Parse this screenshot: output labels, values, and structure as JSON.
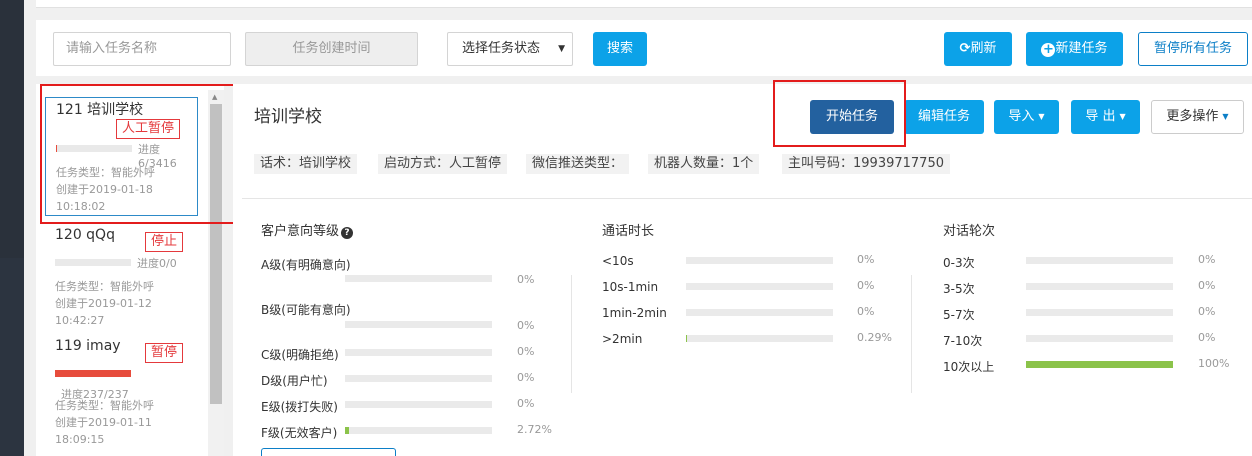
{
  "toolbar": {
    "task_name_placeholder": "请输入任务名称",
    "created_time_placeholder": "任务创建时间",
    "status_select": "选择任务状态",
    "search_label": "搜索",
    "refresh_label": "刷新",
    "new_task_label": "新建任务",
    "pause_all_label": "暂停所有任务"
  },
  "tasks": [
    {
      "name": "121 培训学校",
      "status": "人工暂停",
      "progress": "进度6/3416",
      "progress_fraction": 0.0018,
      "type": "任务类型：智能外呼",
      "created": "创建于2019-01-18",
      "time": "10:18:02"
    },
    {
      "name": "120 qQq",
      "status": "停止",
      "progress": "进度0/0",
      "progress_fraction": 0,
      "type": "任务类型：智能外呼",
      "created": "创建于2019-01-12",
      "time": "10:42:27"
    },
    {
      "name": "119 imay",
      "status": "暂停",
      "progress": "进度237/237",
      "progress_fraction": 1,
      "type": "任务类型：智能外呼",
      "created": "创建于2019-01-11",
      "time": "18:09:15"
    }
  ],
  "detail": {
    "title": "培训学校",
    "actions": {
      "start": "开始任务",
      "edit": "编辑任务",
      "import": "导入",
      "export": "导 出",
      "more": "更多操作"
    },
    "chips": [
      "话术：培训学校",
      "启动方式：人工暂停",
      "微信推送类型：",
      "机器人数量：1个",
      "主叫号码：19939717750"
    ]
  },
  "stats": {
    "intent": {
      "title": "客户意向等级",
      "help_icon": "question-circle-icon",
      "rows": [
        {
          "label": "A级(有明确意向)",
          "pct": "0%",
          "value": 0
        },
        {
          "label": "B级(可能有意向)",
          "pct": "0%",
          "value": 0
        },
        {
          "label": "C级(明确拒绝)",
          "pct": "0%",
          "value": 0
        },
        {
          "label": "D级(用户忙)",
          "pct": "0%",
          "value": 0
        },
        {
          "label": "E级(拨打失败)",
          "pct": "0%",
          "value": 0
        },
        {
          "label": "F级(无效客户)",
          "pct": "2.72%",
          "value": 0.0272
        }
      ]
    },
    "duration": {
      "title": "通话时长",
      "rows": [
        {
          "label": "<10s",
          "pct": "0%",
          "value": 0
        },
        {
          "label": "10s-1min",
          "pct": "0%",
          "value": 0
        },
        {
          "label": "1min-2min",
          "pct": "0%",
          "value": 0
        },
        {
          "label": ">2min",
          "pct": "0.29%",
          "value": 0.0029
        }
      ]
    },
    "rounds": {
      "title": "对话轮次",
      "rows": [
        {
          "label": "0-3次",
          "pct": "0%",
          "value": 0
        },
        {
          "label": "3-5次",
          "pct": "0%",
          "value": 0
        },
        {
          "label": "5-7次",
          "pct": "0%",
          "value": 0
        },
        {
          "label": "7-10次",
          "pct": "0%",
          "value": 0
        },
        {
          "label": "10次以上",
          "pct": "100%",
          "value": 1
        }
      ]
    }
  },
  "colors": {
    "primary": "#0ca2e8",
    "start_button": "#23619f",
    "danger": "#e4393c",
    "bar_fill": "#8bc34a",
    "highlight_box": "#e31c1c"
  }
}
